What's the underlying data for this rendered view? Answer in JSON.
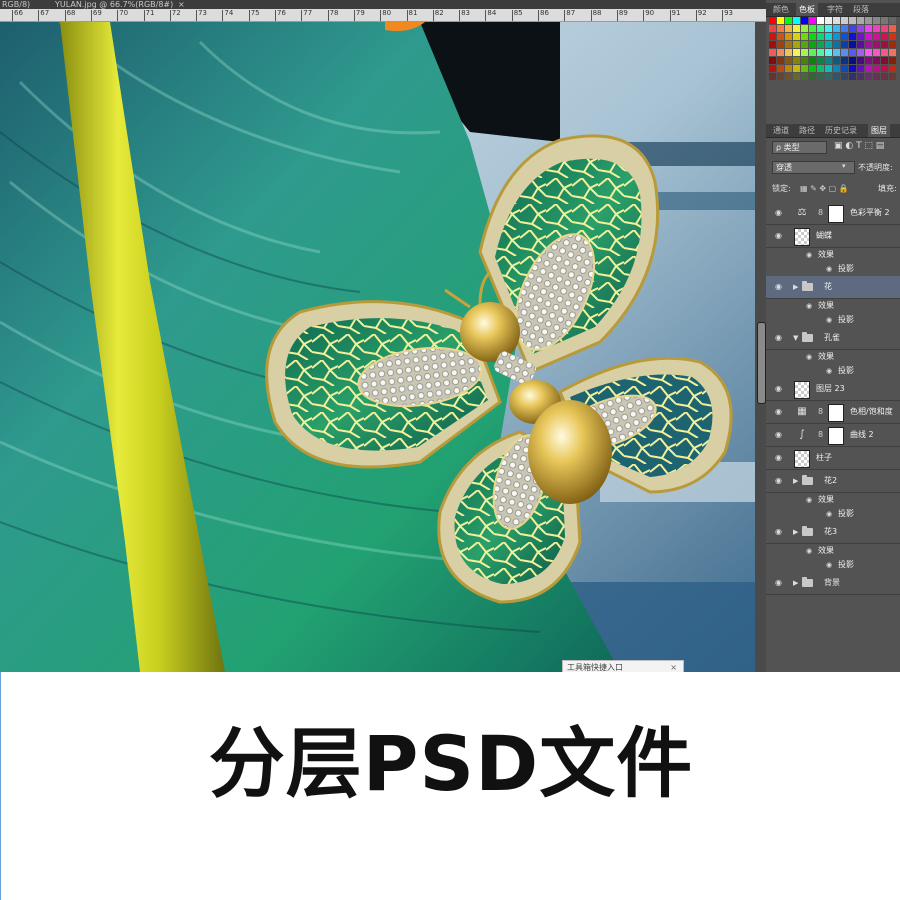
{
  "document": {
    "tab_left_fragment": "RGB/8)",
    "tab_title": "YULAN.jpg @ 66.7%(RGB/8#)",
    "close_glyph": "×"
  },
  "ruler": {
    "labels": [
      "66",
      "67",
      "68",
      "69",
      "70",
      "71",
      "72",
      "73",
      "74",
      "75",
      "76",
      "77",
      "78",
      "79",
      "80",
      "81",
      "82",
      "83",
      "84",
      "85",
      "86",
      "87",
      "88",
      "89",
      "90",
      "91",
      "92",
      "93"
    ]
  },
  "color_panel": {
    "tabs": [
      "颜色",
      "色板",
      "字符",
      "段落"
    ],
    "active_tab": "色板"
  },
  "layers_panel": {
    "tabs": [
      "通道",
      "路径",
      "历史记录",
      "图层"
    ],
    "active_tab": "图层",
    "filter_label": "ρ 类型",
    "blend_mode": "穿透",
    "opacity_label": "不透明度:",
    "lock_label": "锁定:",
    "fill_label": "填充:",
    "layers": [
      {
        "name": "色彩平衡 2",
        "kind": "adjustment",
        "icon": "balance-icon"
      },
      {
        "name": "蝴蝶",
        "kind": "layer"
      },
      {
        "name": "效果",
        "kind": "effects"
      },
      {
        "name": "投影",
        "kind": "effect"
      },
      {
        "name": "花",
        "kind": "group",
        "selected": true
      },
      {
        "name": "效果",
        "kind": "effects"
      },
      {
        "name": "投影",
        "kind": "effect"
      },
      {
        "name": "孔雀",
        "kind": "group-open"
      },
      {
        "name": "效果",
        "kind": "effects"
      },
      {
        "name": "投影",
        "kind": "effect"
      },
      {
        "name": "图层 23",
        "kind": "layer"
      },
      {
        "name": "色相/饱和度",
        "kind": "adjustment",
        "icon": "hue-saturation-icon"
      },
      {
        "name": "曲线 2",
        "kind": "adjustment",
        "icon": "curves-icon"
      },
      {
        "name": "柱子",
        "kind": "layer"
      },
      {
        "name": "花2",
        "kind": "group"
      },
      {
        "name": "效果",
        "kind": "effects"
      },
      {
        "name": "投影",
        "kind": "effect"
      },
      {
        "name": "花3",
        "kind": "group"
      },
      {
        "name": "效果",
        "kind": "effects"
      },
      {
        "name": "投影",
        "kind": "effect"
      },
      {
        "name": "背景",
        "kind": "group"
      }
    ]
  },
  "tooltip": {
    "text": "工具箱快捷入口"
  },
  "caption": {
    "text": "分层PSD文件"
  },
  "colors": {
    "panel_bg": "#535353",
    "selected_layer": "#5e6a80",
    "caption_text": "#111111"
  }
}
